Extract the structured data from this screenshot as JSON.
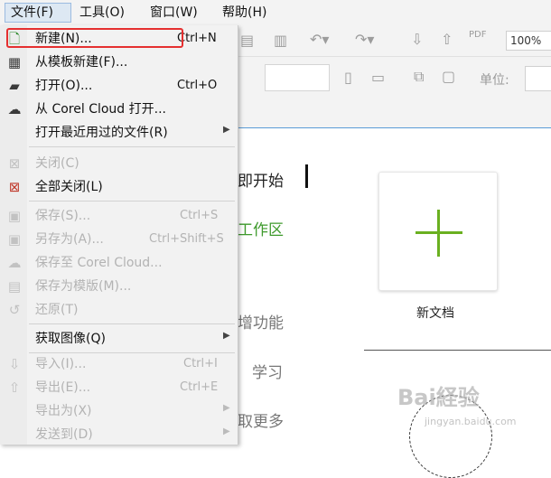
{
  "menubar": {
    "file": "文件(F)",
    "tools": "工具(O)",
    "window": "窗口(W)",
    "help": "帮助(H)"
  },
  "toolbar": {
    "zoom": "100%",
    "unit_label": "单位:",
    "pdf": "PDF"
  },
  "welcome": {
    "start": "即开始",
    "workspace": "工作区",
    "features": "增功能",
    "learn": "学习",
    "more": "取更多",
    "new_doc": "新文档"
  },
  "file_menu": {
    "items": [
      {
        "label": "新建(N)...",
        "shortcut": "Ctrl+N",
        "icon": "new-file-icon",
        "disabled": false
      },
      {
        "label": "从模板新建(F)...",
        "shortcut": "",
        "icon": "template-icon",
        "disabled": false
      },
      {
        "label": "打开(O)...",
        "shortcut": "Ctrl+O",
        "icon": "folder-open-icon",
        "disabled": false
      },
      {
        "label": "从 Corel Cloud 打开...",
        "shortcut": "",
        "icon": "cloud-download-icon",
        "disabled": false
      },
      {
        "label": "打开最近用过的文件(R)",
        "shortcut": "",
        "icon": "",
        "disabled": false,
        "submenu": true
      },
      {
        "label": "关闭(C)",
        "shortcut": "",
        "icon": "close-doc-icon",
        "disabled": true
      },
      {
        "label": "全部关闭(L)",
        "shortcut": "",
        "icon": "close-all-icon",
        "disabled": false
      },
      {
        "label": "保存(S)...",
        "shortcut": "Ctrl+S",
        "icon": "save-icon",
        "disabled": true
      },
      {
        "label": "另存为(A)...",
        "shortcut": "Ctrl+Shift+S",
        "icon": "save-as-icon",
        "disabled": true
      },
      {
        "label": "保存至 Corel Cloud...",
        "shortcut": "",
        "icon": "cloud-upload-icon",
        "disabled": true
      },
      {
        "label": "保存为模版(M)...",
        "shortcut": "",
        "icon": "save-template-icon",
        "disabled": true
      },
      {
        "label": "还原(T)",
        "shortcut": "",
        "icon": "revert-icon",
        "disabled": true
      },
      {
        "label": "获取图像(Q)",
        "shortcut": "",
        "icon": "",
        "disabled": false,
        "submenu": true
      },
      {
        "label": "导入(I)...",
        "shortcut": "Ctrl+I",
        "icon": "import-icon",
        "disabled": true
      },
      {
        "label": "导出(E)...",
        "shortcut": "Ctrl+E",
        "icon": "export-icon",
        "disabled": true
      },
      {
        "label": "导出为(X)",
        "shortcut": "",
        "icon": "",
        "disabled": true,
        "submenu": true
      },
      {
        "label": "发送到(D)",
        "shortcut": "",
        "icon": "",
        "disabled": true,
        "submenu": true
      }
    ]
  },
  "watermark": {
    "text": "Bai経验",
    "sub": "jingyan.baidu.com"
  }
}
